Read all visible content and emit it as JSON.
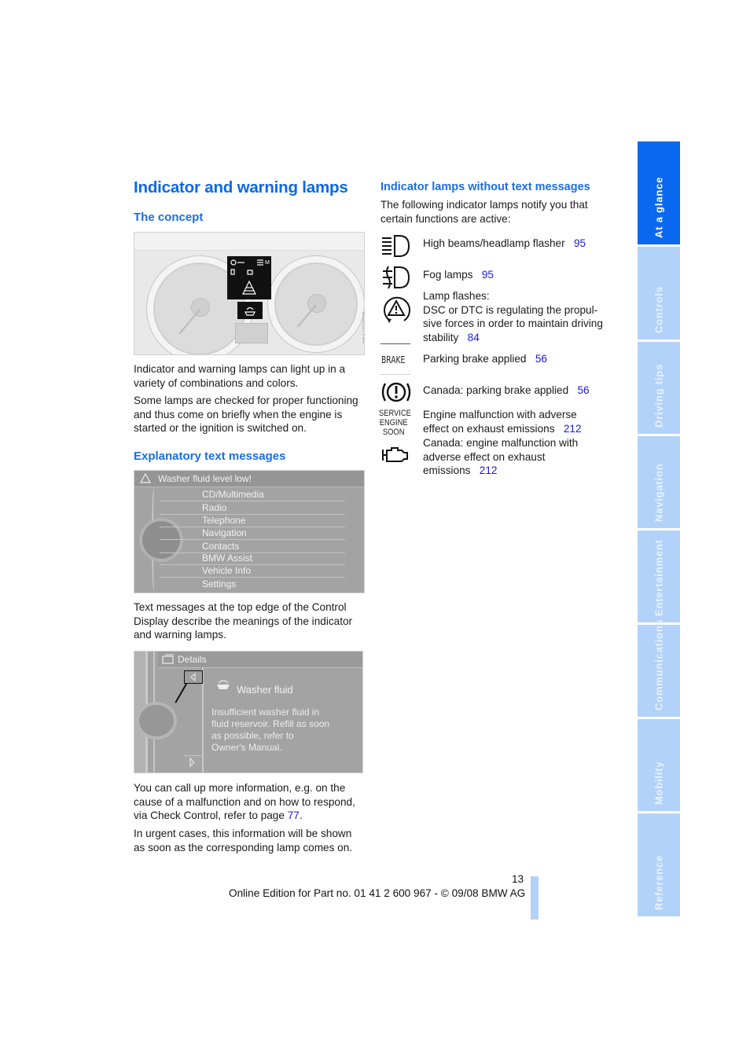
{
  "page": {
    "title": "Indicator and warning lamps",
    "page_number": "13",
    "footer": "Online Edition for Part no. 01 41 2 600 967  - © 09/08 BMW AG"
  },
  "left_column": {
    "concept_heading": "The concept",
    "figure1_code": "W0BM0ZFPMA",
    "concept_p1": "Indicator and warning lamps can light up in a variety of combinations and colors.",
    "concept_p2": "Some lamps are checked for proper functioning and thus come on briefly when the engine is started or the ignition is switched on.",
    "explanatory_heading": "Explanatory text messages",
    "menu_screen": {
      "title": "Washer fluid level low!",
      "items": [
        "CD/Multimedia",
        "Radio",
        "Telephone",
        "Navigation",
        "Contacts",
        "BMW Assist",
        "Vehicle Info",
        "Settings"
      ]
    },
    "explanatory_p1": "Text messages at the top edge of the Control Display describe the meanings of the indicator and warning lamps.",
    "details_screen": {
      "title": "Details",
      "heading": "Washer fluid",
      "body_lines": [
        "Insufficient washer fluid in",
        "fluid reservoir. Refill as soon",
        "as possible, refer to",
        "Owner's Manual."
      ]
    },
    "more_info_text": "You can call up more information, e.g. on the cause of a malfunction and on how to respond, via Check Control, refer to page ",
    "more_info_page": "77",
    "more_info_end": ".",
    "urgent_text": "In urgent cases, this information will be shown as soon as the corresponding lamp comes on."
  },
  "right_column": {
    "heading": "Indicator lamps without text messages",
    "intro": "The following indicator lamps notify you that certain functions are active:",
    "lamps": [
      {
        "icon": "high-beam-icon",
        "lines": [
          "High beams/headlamp flasher"
        ],
        "page": "95"
      },
      {
        "icon": "fog-lamp-icon",
        "lines": [
          "Fog lamps"
        ],
        "page": "95"
      },
      {
        "icon": "dsc-warning-icon",
        "lines": [
          "Lamp flashes:",
          "DSC or DTC is regulating the propul-",
          "sive forces in order to maintain driving",
          "stability"
        ],
        "page": "84"
      },
      {
        "icon": "brake-text-icon",
        "icon_text": "BRAKE",
        "lines": [
          "Parking brake applied"
        ],
        "page": "56"
      },
      {
        "icon": "canada-parking-brake-icon",
        "lines": [
          "Canada: parking brake applied"
        ],
        "page": "56"
      },
      {
        "icon": "service-engine-soon-icon",
        "icon_text": [
          "SERVICE",
          "ENGINE",
          "SOON"
        ],
        "lines": [
          "Engine malfunction with adverse",
          "effect on exhaust emissions"
        ],
        "page": "212"
      },
      {
        "icon": "engine-check-icon",
        "lines": [
          "Canada: engine malfunction with",
          "adverse effect on exhaust",
          "emissions"
        ],
        "page": "212"
      }
    ]
  },
  "side_tabs": [
    {
      "label": "At a glance",
      "active": true
    },
    {
      "label": "Controls",
      "active": false
    },
    {
      "label": "Driving tips",
      "active": false
    },
    {
      "label": "Navigation",
      "active": false
    },
    {
      "label": "Entertainment",
      "active": false
    },
    {
      "label": "Communications",
      "active": false
    },
    {
      "label": "Mobility",
      "active": false
    },
    {
      "label": "Reference",
      "active": false
    }
  ],
  "colors": {
    "heading_blue": "#0a68e8",
    "link_blue": "#1a1adc",
    "tab_active": "#0a68f0",
    "tab_inactive": "#b3d2fa"
  }
}
